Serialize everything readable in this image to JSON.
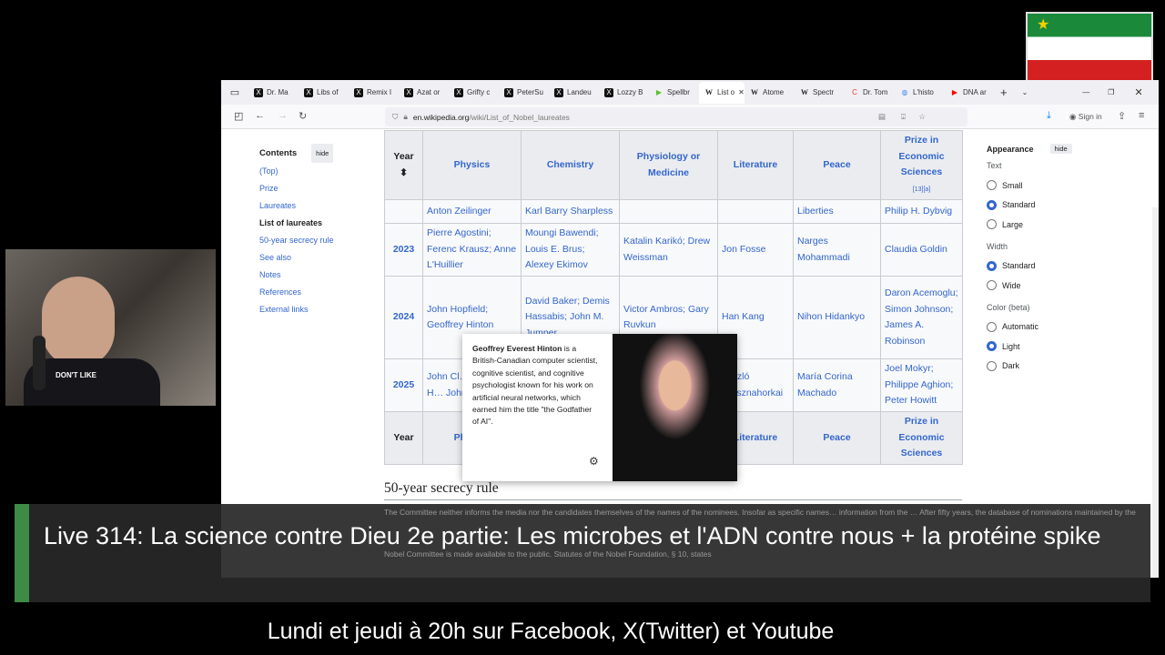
{
  "browser": {
    "tabs": [
      {
        "label": "Dr. Ma",
        "icon": "x"
      },
      {
        "label": "Libs of",
        "icon": "x"
      },
      {
        "label": "Remix I",
        "icon": "x"
      },
      {
        "label": "Azat or",
        "icon": "x"
      },
      {
        "label": "Grifty c",
        "icon": "x"
      },
      {
        "label": "PeterSu",
        "icon": "x"
      },
      {
        "label": "Landeu",
        "icon": "x"
      },
      {
        "label": "Lozzy B",
        "icon": "x"
      },
      {
        "label": "Spellbr",
        "icon": "rumble"
      },
      {
        "label": "List o",
        "icon": "w",
        "active": true
      },
      {
        "label": "Atome",
        "icon": "w"
      },
      {
        "label": "Spectr",
        "icon": "w"
      },
      {
        "label": "Dr. Tom",
        "icon": "c"
      },
      {
        "label": "L'histo",
        "icon": "globe"
      },
      {
        "label": "DNA ar",
        "icon": "youtube"
      }
    ],
    "url_domain": "en.wikipedia.org",
    "url_path": "/wiki/List_of_Nobel_laureates",
    "sign_in": "Sign in"
  },
  "toc": {
    "title": "Contents",
    "hide": "hide",
    "items": [
      "(Top)",
      "Prize",
      "Laureates",
      "List of laureates",
      "50-year secrecy rule",
      "See also",
      "Notes",
      "References",
      "External links"
    ],
    "current": 3
  },
  "table": {
    "headers": [
      "Year",
      "Physics",
      "Chemistry",
      "Physiology or Medicine",
      "Literature",
      "Peace",
      "Prize in Economic Sciences"
    ],
    "econ_refs": "[13][a]",
    "partial_row": [
      "",
      "Anton Zeilinger",
      "Karl Barry Sharpless",
      "",
      "",
      "Liberties",
      "Philip H. Dybvig"
    ],
    "rows": [
      {
        "year": "2023",
        "physics": "Pierre Agostini; Ferenc Krausz; Anne L'Huillier",
        "chemistry": "Moungi Bawendi; Louis E. Brus; Alexey Ekimov",
        "medicine": "Katalin Karikó; Drew Weissman",
        "literature": "Jon Fosse",
        "peace": "Narges Mohammadi",
        "economics": "Claudia Goldin"
      },
      {
        "year": "2024",
        "physics": "John Hopfield; Geoffrey Hinton",
        "chemistry": "David Baker; Demis Hassabis; John M. Jumper",
        "medicine": "Victor Ambros; Gary Ruvkun",
        "literature": "Han Kang",
        "peace": "Nihon Hidankyo",
        "economics": "Daron Acemoglu; Simon Johnson; James A. Robinson"
      },
      {
        "year": "2025",
        "physics": "John Cl… Michel H… John M.",
        "chemistry": "",
        "medicine": "",
        "literature": "László Krasznahorkai",
        "peace": "María Corina Machado",
        "economics": "Joel Mokyr; Philippe Aghion; Peter Howitt"
      }
    ],
    "footer": [
      "Year",
      "Physics",
      "Chemistry",
      "Physiology or Medicine",
      "Literature",
      "Peace",
      "Prize in Economic Sciences"
    ]
  },
  "popup": {
    "name": "Geoffrey Everest Hinton",
    "text": " is a British-Canadian computer scientist, cognitive scientist, and cognitive psychologist known for his work on artificial neural networks, which earned him the title \"the Godfather of AI\"."
  },
  "appearance": {
    "title": "Appearance",
    "hide": "hide",
    "groups": [
      {
        "label": "Text",
        "options": [
          "Small",
          "Standard",
          "Large"
        ],
        "selected": 1
      },
      {
        "label": "Width",
        "options": [
          "Standard",
          "Wide"
        ],
        "selected": 0
      },
      {
        "label": "Color (beta)",
        "options": [
          "Automatic",
          "Light",
          "Dark"
        ],
        "selected": 1
      }
    ]
  },
  "section": {
    "title": "50-year secrecy rule",
    "paragraph": "The Committee neither informs the media nor the candidates themselves of the names of the nominees. Insofar as specific names… information from the … After fifty years, the database of nominations maintained by the Nobel Committee is made available to the public. Statutes of the Nobel Foundation, § 10, states"
  },
  "stream": {
    "title": "Live 314: La science contre Dieu 2e partie: Les microbes et l'ADN contre nous + la protéine spike",
    "schedule": "Lundi et jeudi à 20h sur Facebook, X(Twitter) et Youtube",
    "shirt_text": "DON'T LIKE"
  },
  "colors": {
    "link": "#3366cc",
    "banner_accent": "#3d8b45"
  }
}
